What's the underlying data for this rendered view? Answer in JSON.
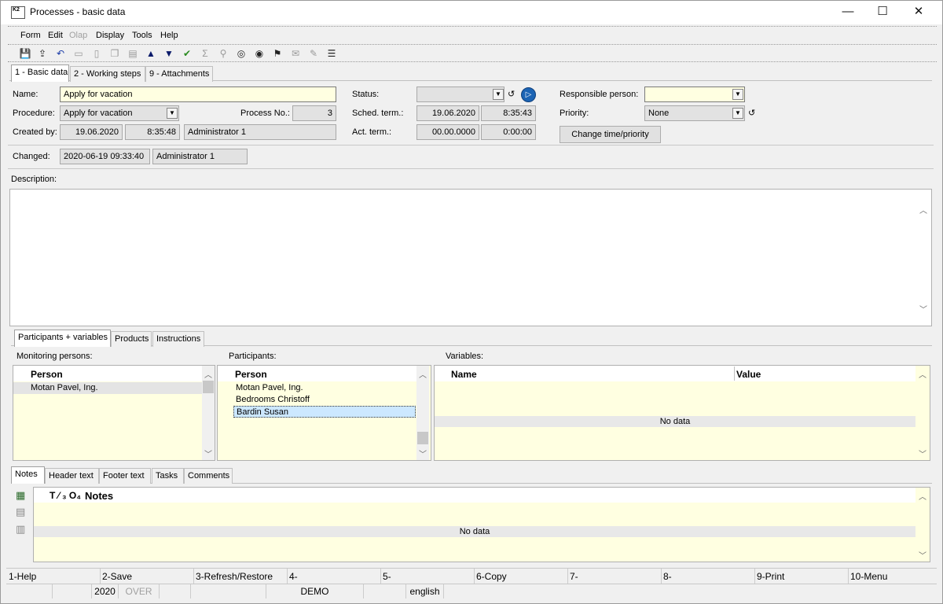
{
  "window": {
    "title": "Processes - basic data",
    "icon_text": "K2",
    "minimize": "—",
    "maximize": "☐",
    "close": "✕"
  },
  "menu": [
    "Form",
    "Edit",
    "Olap",
    "Display",
    "Tools",
    "Help"
  ],
  "toolbar_icons": [
    "save-icon",
    "save-as-icon",
    "undo-icon",
    "open-folder-icon",
    "new-document-icon",
    "copy-document-icon",
    "book-icon",
    "arrow-up-icon",
    "arrow-down-icon",
    "check-icon",
    "sum-icon",
    "filter-icon",
    "binoculars-icon",
    "binoculars-next-icon",
    "run-icon",
    "mail-icon",
    "edit-icon",
    "hamburger-menu-icon"
  ],
  "main_tabs": [
    "1 - Basic data",
    "2 - Working steps",
    "9 - Attachments"
  ],
  "form": {
    "name_label": "Name:",
    "name_value": "Apply for vacation",
    "procedure_label": "Procedure:",
    "procedure_value": "Apply for vacation",
    "process_no_label": "Process No.:",
    "process_no_value": "3",
    "created_by_label": "Created by:",
    "created_date": "19.06.2020",
    "created_time": "8:35:48",
    "created_user": "Administrator 1",
    "status_label": "Status:",
    "status_value": "",
    "sched_term_label": "Sched. term.:",
    "sched_date": "19.06.2020",
    "sched_time": "8:35:43",
    "act_term_label": "Act. term.:",
    "act_date": "00.00.0000",
    "act_time": "0:00:00",
    "responsible_label": "Responsible person:",
    "responsible_value": "",
    "priority_label": "Priority:",
    "priority_value": "None",
    "change_button": "Change time/priority",
    "changed_label": "Changed:",
    "changed_value": "2020-06-19 09:33:40",
    "changed_user": "Administrator 1",
    "description_label": "Description:"
  },
  "mid_tabs": [
    "Participants + variables",
    "Products",
    "Instructions"
  ],
  "monitoring": {
    "label": "Monitoring persons:",
    "header": "Person",
    "rows": [
      "Motan Pavel, Ing."
    ]
  },
  "participants": {
    "label": "Participants:",
    "header": "Person",
    "rows": [
      "Motan Pavel, Ing.",
      "Bedrooms Christoff",
      "Bardin Susan"
    ]
  },
  "variables": {
    "label": "Variables:",
    "col_name": "Name",
    "col_value": "Value",
    "empty": "No data"
  },
  "bottom_tabs": [
    "Notes",
    "Header text",
    "Footer text",
    "Tasks",
    "Comments"
  ],
  "notes": {
    "header_prefix": "T ⁄ ₃ O₄",
    "header": "Notes",
    "empty": "No data"
  },
  "fkeys": [
    "1-Help",
    "2-Save",
    "3-Refresh/Restore",
    "4-",
    "5-",
    "6-Copy",
    "7-",
    "8-",
    "9-Print",
    "10-Menu"
  ],
  "status_bar": {
    "year": "2020",
    "mode": "OVER",
    "db": "DEMO",
    "lang": "english"
  },
  "colors": {
    "field_yellow": "#ffffe1",
    "play_button": "#1c64b4"
  }
}
